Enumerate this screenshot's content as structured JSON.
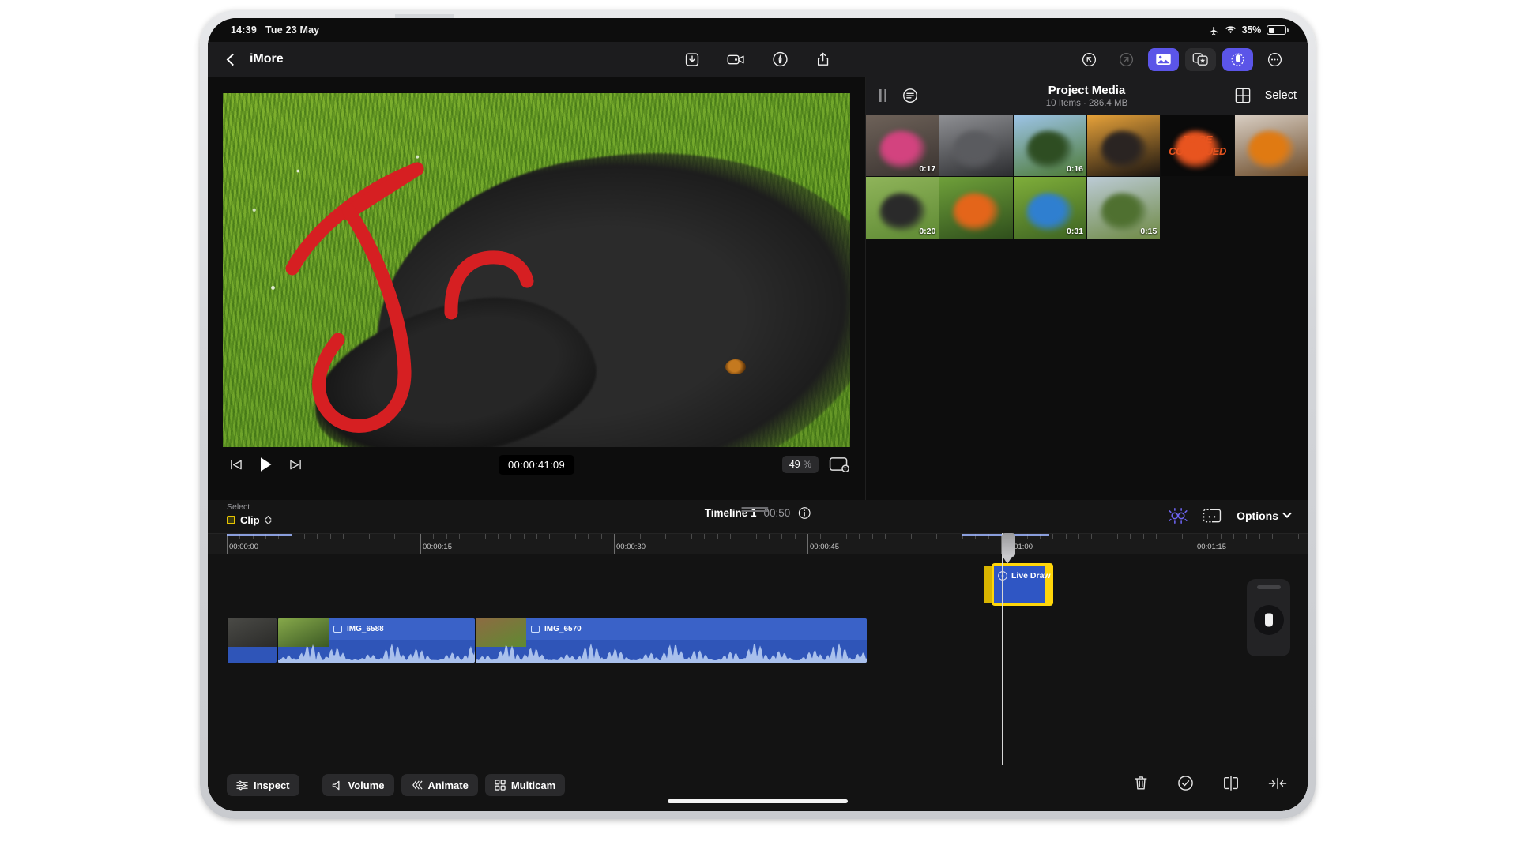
{
  "device": {
    "statusbar": {
      "time": "14:39",
      "date": "Tue 23 May",
      "airplane_icon": "airplane-icon",
      "wifi_icon": "wifi-icon",
      "battery_percent": "35%"
    }
  },
  "navbar": {
    "back_icon": "chevron-left-icon",
    "project_title": "iMore",
    "center_tools": [
      {
        "name": "import-media-icon",
        "label": "Import"
      },
      {
        "name": "record-video-icon",
        "label": "Record"
      },
      {
        "name": "live-drawing-icon",
        "label": "Live Drawing"
      },
      {
        "name": "share-icon",
        "label": "Share"
      }
    ],
    "right_tools": [
      {
        "name": "undo-icon",
        "label": "Undo",
        "state": "enabled"
      },
      {
        "name": "redo-icon",
        "label": "Redo",
        "state": "disabled"
      },
      {
        "name": "media-browser-icon",
        "label": "Media Browser",
        "state": "active"
      },
      {
        "name": "effects-icon",
        "label": "Effects",
        "state": "inactive"
      },
      {
        "name": "audio-icon",
        "label": "Audio",
        "state": "active"
      },
      {
        "name": "more-options-icon",
        "label": "More",
        "state": "enabled"
      }
    ]
  },
  "preview": {
    "annotation_color": "#d61f22",
    "annotation_description": "Red hand-drawn J stroke and arc over video",
    "controls": {
      "skip_back_icon": "skip-to-start-icon",
      "play_icon": "play-icon",
      "skip_forward_icon": "skip-to-end-icon",
      "timecode": "00:00:41:09",
      "zoom_value": "49",
      "zoom_unit": "%",
      "viewer_options_icon": "viewer-options-icon"
    }
  },
  "media_browser": {
    "pause_icon": "pause-icon",
    "filter_icon": "filter-icon",
    "title": "Project Media",
    "subtitle": "10 Items  ·  286.4 MB",
    "grid_view_icon": "grid-view-icon",
    "select_label": "Select",
    "items": [
      {
        "duration": "0:17",
        "label": "",
        "c1": "#6e6259",
        "c2": "#3a3330",
        "accent": "#d3437f"
      },
      {
        "duration": "",
        "label": "",
        "c1": "#8f9094",
        "c2": "#2c2d30",
        "accent": "#5a5b5f"
      },
      {
        "duration": "0:16",
        "label": "",
        "c1": "#9dc4e8",
        "c2": "#4d7a36",
        "accent": "#2e4d22"
      },
      {
        "duration": "",
        "label": "",
        "c1": "#e8a33a",
        "c2": "#1a1410",
        "accent": "#2a2422"
      },
      {
        "duration": "",
        "label": "TO BE CONTINUED",
        "c1": "#0a0a0a",
        "c2": "#0a0a0a",
        "accent": "#e8541f"
      },
      {
        "duration": "",
        "label": "",
        "c1": "#d9cfc4",
        "c2": "#6b4a28",
        "accent": "#e07a12"
      },
      {
        "duration": "0:20",
        "label": "",
        "c1": "#8fb45a",
        "c2": "#5f8a34",
        "accent": "#2a2a2a"
      },
      {
        "duration": "",
        "label": "",
        "c1": "#6fa03a",
        "c2": "#2f4f1c",
        "accent": "#e4651a"
      },
      {
        "duration": "0:31",
        "label": "",
        "c1": "#7fae3a",
        "c2": "#3e6422",
        "accent": "#2f7fd0"
      },
      {
        "duration": "0:15",
        "label": "",
        "c1": "#bccbd6",
        "c2": "#6f8a45",
        "accent": "#4f7030"
      }
    ]
  },
  "timeline": {
    "select_label": "Select",
    "select_value": "Clip",
    "select_chevron_icon": "chevron-updown-icon",
    "name": "Timeline 1",
    "duration": "00:50",
    "info_icon": "info-icon",
    "magnetic_icon": "magnetic-timeline-icon",
    "transition_icon": "transitions-icon",
    "options_label": "Options",
    "options_chevron_icon": "chevron-down-icon",
    "ruler_labels": [
      "00:00:00",
      "00:00:15",
      "00:00:30",
      "00:00:45",
      "00:01:00",
      "00:01:15"
    ],
    "overlay_clip": {
      "label": "Live Draw",
      "icon": "live-drawing-icon",
      "selected": true
    },
    "clips": [
      {
        "name": "",
        "thumb1": "#4a4a46",
        "thumb2": "#2a2a28"
      },
      {
        "name": "IMG_6588",
        "thumb1": "#86a84a",
        "thumb2": "#3c5a24"
      },
      {
        "name": "IMG_6570",
        "thumb1": "#8d6b42",
        "thumb2": "#5f8a32"
      }
    ],
    "pencil_dock_icon": "apple-pencil-icon"
  },
  "bottombar": {
    "buttons": [
      {
        "label": "Inspect",
        "icon": "sliders-icon"
      },
      {
        "label": "Volume",
        "icon": "speaker-icon"
      },
      {
        "label": "Animate",
        "icon": "animate-icon"
      },
      {
        "label": "Multicam",
        "icon": "multicam-icon"
      }
    ],
    "right_icons": [
      {
        "name": "trash-icon",
        "label": "Delete"
      },
      {
        "name": "check-circle-icon",
        "label": "Apply"
      },
      {
        "name": "split-clip-icon",
        "label": "Split"
      },
      {
        "name": "trim-to-playhead-icon",
        "label": "Trim"
      }
    ]
  }
}
